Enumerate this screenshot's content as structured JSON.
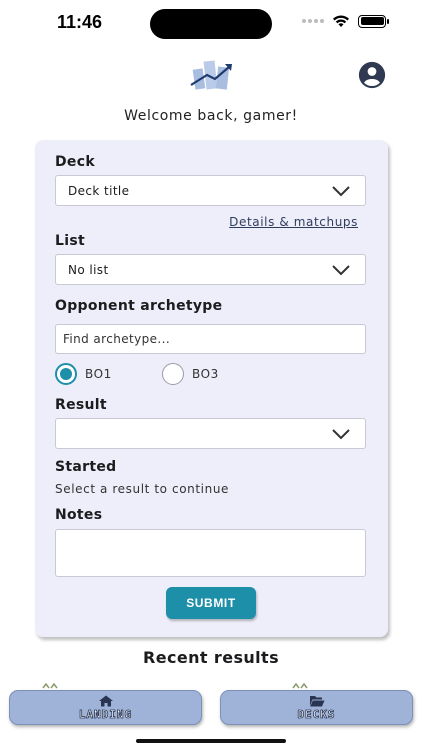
{
  "status_bar": {
    "time": "11:46"
  },
  "header": {
    "welcome": "Welcome back, gamer!"
  },
  "form": {
    "deck_label": "Deck",
    "deck_value": "Deck title",
    "details_link": "Details & matchups",
    "list_label": "List",
    "list_value": "No list",
    "opponent_label": "Opponent archetype",
    "opponent_placeholder": "Find archetype...",
    "bo1_label": "BO1",
    "bo3_label": "BO3",
    "selected_format": "BO1",
    "result_label": "Result",
    "result_value": "",
    "started_label": "Started",
    "started_helper": "Select a result to continue",
    "notes_label": "Notes",
    "submit_label": "SUBMIT"
  },
  "recent": {
    "title": "Recent results"
  },
  "nav": {
    "landing_label": "LANDING",
    "decks_label": "DECKS"
  },
  "colors": {
    "accent": "#1e8fa8",
    "card_bg": "#eeeefa",
    "nav_bg": "#9fb3d8"
  }
}
